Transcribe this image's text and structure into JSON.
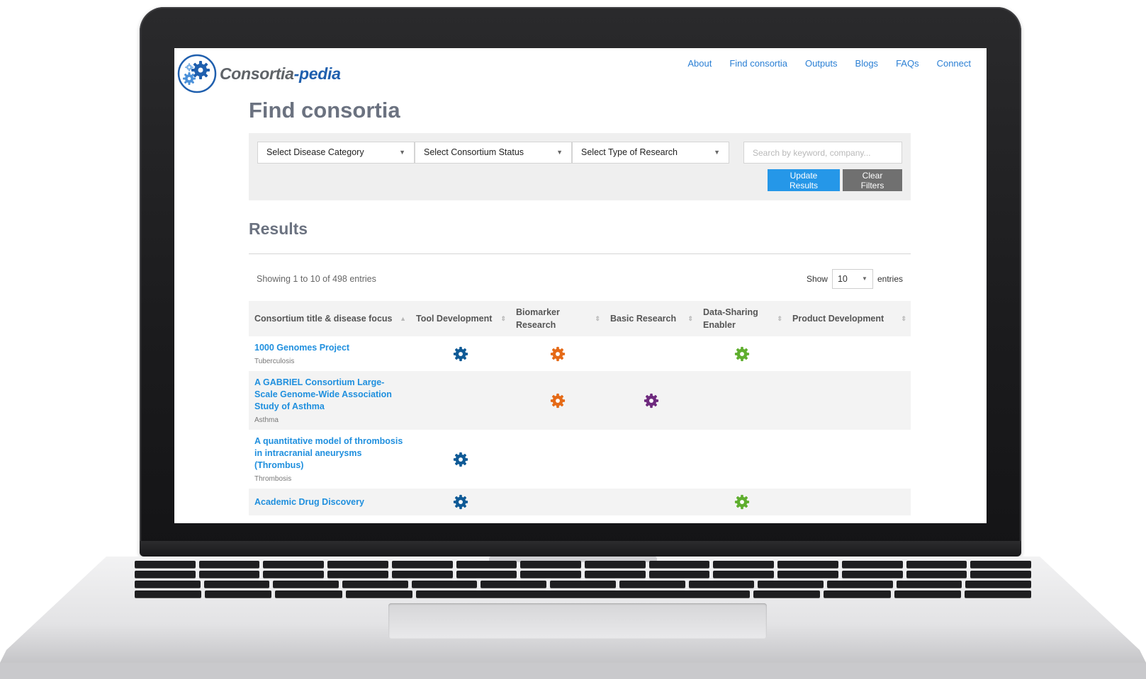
{
  "brand": {
    "name_main": "Consortia",
    "name_accent": "-pedia"
  },
  "nav": [
    {
      "label": "About"
    },
    {
      "label": "Find consortia"
    },
    {
      "label": "Outputs"
    },
    {
      "label": "Blogs"
    },
    {
      "label": "FAQs"
    },
    {
      "label": "Connect"
    }
  ],
  "page": {
    "title": "Find consortia"
  },
  "filters": {
    "disease_category": "Select Disease Category",
    "consortium_status": "Select Consortium Status",
    "type_of_research": "Select Type of Research",
    "search_placeholder": "Search by keyword, company...",
    "update_label": "Update Results",
    "clear_label": "Clear Filters"
  },
  "results": {
    "title": "Results",
    "showing": "Showing 1 to 10 of 498 entries",
    "show_label": "Show",
    "page_length": "10",
    "entries_label": "entries",
    "columns": [
      "Consortium title & disease focus",
      "Tool Development",
      "Biomarker Research",
      "Basic Research",
      "Data-Sharing Enabler",
      "Product Development"
    ],
    "rows": [
      {
        "title": "1000 Genomes Project",
        "disease": "Tuberculosis",
        "flags": [
          true,
          true,
          false,
          true,
          false
        ]
      },
      {
        "title": "A GABRIEL Consortium Large-Scale Genome-Wide Association Study of Asthma",
        "disease": "Asthma",
        "flags": [
          false,
          true,
          true,
          false,
          false
        ]
      },
      {
        "title": "A quantitative model of thrombosis in intracranial aneurysms (Thrombus)",
        "disease": "Thrombosis",
        "flags": [
          true,
          false,
          false,
          false,
          false
        ]
      },
      {
        "title": "Academic Drug Discovery",
        "disease": "",
        "flags": [
          true,
          false,
          false,
          true,
          false
        ]
      }
    ]
  },
  "colors": {
    "tool": "#0f5a96",
    "biomarker": "#e56a17",
    "basic": "#6e2a7e",
    "datasharing": "#5fae2e",
    "product": "#2597e8",
    "link": "#1f8fde",
    "update_button": "#2597e8",
    "clear_button": "#707070"
  }
}
